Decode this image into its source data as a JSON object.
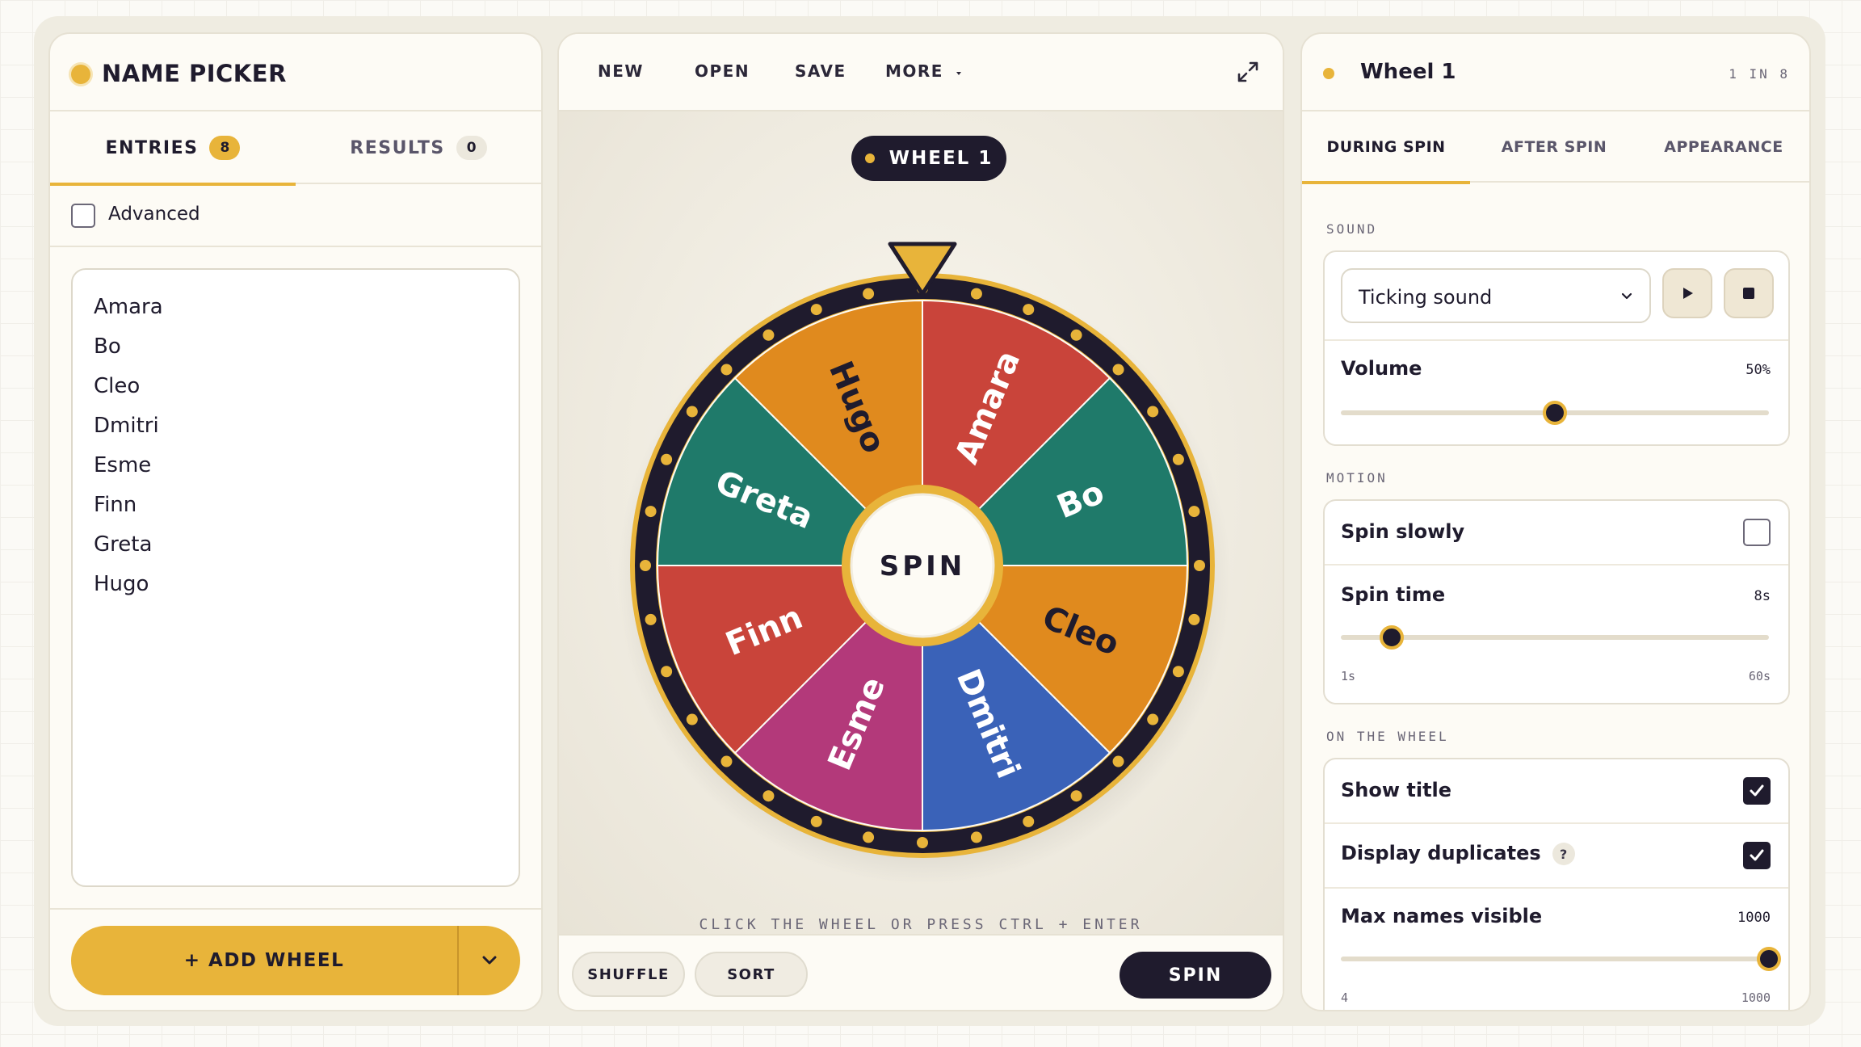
{
  "app": {
    "title": "NAME PICKER"
  },
  "left": {
    "tabs": [
      {
        "label": "ENTRIES",
        "count": "8"
      },
      {
        "label": "RESULTS",
        "count": "0"
      }
    ],
    "advanced_label": "Advanced",
    "entries": [
      "Amara",
      "Bo",
      "Cleo",
      "Dmitri",
      "Esme",
      "Finn",
      "Greta",
      "Hugo"
    ],
    "add_wheel_label": "+ ADD WHEEL"
  },
  "toolbar": {
    "new": "NEW",
    "open": "OPEN",
    "save": "SAVE",
    "more": "MORE"
  },
  "wheel": {
    "title_pill": "WHEEL 1",
    "center_label": "SPIN",
    "hint": "CLICK THE WHEEL OR PRESS CTRL + ENTER",
    "segments": [
      {
        "name": "Amara",
        "color": "#c9443a",
        "text_color": "#ffffff"
      },
      {
        "name": "Bo",
        "color": "#1f7a6a",
        "text_color": "#ffffff"
      },
      {
        "name": "Cleo",
        "color": "#e08a1e",
        "text_color": "#1f1b2d"
      },
      {
        "name": "Dmitri",
        "color": "#3a62b8",
        "text_color": "#ffffff"
      },
      {
        "name": "Esme",
        "color": "#b3397a",
        "text_color": "#ffffff"
      },
      {
        "name": "Finn",
        "color": "#c9443a",
        "text_color": "#ffffff"
      },
      {
        "name": "Greta",
        "color": "#1f7a6a",
        "text_color": "#ffffff"
      },
      {
        "name": "Hugo",
        "color": "#e08a1e",
        "text_color": "#1f1b2d"
      }
    ],
    "colors": {
      "rim": "#1f1b2d",
      "gold": "#e8b43a",
      "pointer": "#e8b43a"
    }
  },
  "bottom": {
    "shuffle": "SHUFFLE",
    "sort": "SORT",
    "spin": "SPIN"
  },
  "settings": {
    "wheel_name": "Wheel 1",
    "position": "1 IN 8",
    "tabs": [
      "DURING SPIN",
      "AFTER SPIN",
      "APPEARANCE"
    ],
    "sound": {
      "section": "SOUND",
      "selected": "Ticking sound",
      "volume_label": "Volume",
      "volume_value": "50%",
      "volume_fraction": 0.5
    },
    "motion": {
      "section": "MOTION",
      "spin_slowly_label": "Spin slowly",
      "spin_slowly": false,
      "spin_time_label": "Spin time",
      "spin_time_value": "8s",
      "spin_time": 8,
      "spin_min": "1s",
      "spin_max": "60s",
      "spin_min_num": 1,
      "spin_max_num": 60
    },
    "on_wheel": {
      "section": "ON THE WHEEL",
      "show_title_label": "Show title",
      "show_title": true,
      "display_duplicates_label": "Display duplicates",
      "display_duplicates": true,
      "help_glyph": "?",
      "max_names_label": "Max names visible",
      "max_names_value": "1000",
      "max_names": 1000,
      "max_min": "4",
      "max_max": "1000",
      "max_min_num": 4,
      "max_max_num": 1000
    }
  }
}
